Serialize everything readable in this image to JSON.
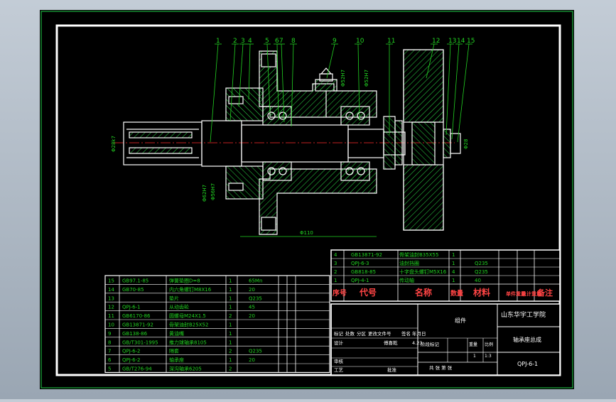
{
  "colors": {
    "background": "#000000",
    "frame": "#ffffff",
    "outer_border": "#1fd24a",
    "part_lines": "#ffffff",
    "hatch": "#2ee04a",
    "leaders": "#22d322",
    "center_lines": "#ff2a2a",
    "dimensions": "#22d322",
    "table_text": "#22d322",
    "title_accent": "#ff4444"
  },
  "balloons": [
    "1",
    "2",
    "3",
    "4",
    "5",
    "6",
    "7",
    "8",
    "9",
    "10",
    "11",
    "12",
    "13",
    "14",
    "15"
  ],
  "dimensions": {
    "left_shaft_dia": "Φ28k7",
    "right_dia": "Φ28",
    "flange_dia_a": "Φ62H7",
    "flange_dia_b": "Φ56H7",
    "top_dia_a": "Φ52H7",
    "top_dia_b": "Φ52H7",
    "length": "Φ110"
  },
  "bom_lower": {
    "rows": [
      {
        "no": "15",
        "code": "GB97.1-85",
        "name": "弹簧垫圈D=8",
        "qty": "1",
        "material": "65Mn"
      },
      {
        "no": "14",
        "code": "GB70-85",
        "name": "内六角螺钉M8X16",
        "qty": "1",
        "material": "20"
      },
      {
        "no": "13",
        "code": "",
        "name": "垫片",
        "qty": "1",
        "material": "Q235"
      },
      {
        "no": "12",
        "code": "QPJ-6-1",
        "name": "从动齿轮",
        "qty": "1",
        "material": "45"
      },
      {
        "no": "11",
        "code": "GB6170-86",
        "name": "圆螺母M24X1.5",
        "qty": "2",
        "material": "20"
      },
      {
        "no": "10",
        "code": "GB13871-92",
        "name": "骨架油封B25X52",
        "qty": "1",
        "material": ""
      },
      {
        "no": "9",
        "code": "GB138-86",
        "name": "黄油嘴",
        "qty": "1",
        "material": ""
      },
      {
        "no": "8",
        "code": "GB/T301-1995",
        "name": "推力球轴承8105",
        "qty": "1",
        "material": ""
      },
      {
        "no": "7",
        "code": "QPJ-6-2",
        "name": "隔套",
        "qty": "2",
        "material": "Q235"
      },
      {
        "no": "6",
        "code": "QPJ-6-2",
        "name": "轴承座",
        "qty": "1",
        "material": "20"
      },
      {
        "no": "5",
        "code": "GB/T276-94",
        "name": "深沟轴承6205",
        "qty": "2",
        "material": ""
      }
    ]
  },
  "bom_upper": {
    "rows": [
      {
        "no": "4",
        "code": "GB13871-92",
        "name": "骨架油封B35X55",
        "qty": "1",
        "material": ""
      },
      {
        "no": "3",
        "code": "QPJ-6-3",
        "name": "油封挡圈",
        "qty": "1",
        "material": "Q235"
      },
      {
        "no": "2",
        "code": "GB818-85",
        "name": "十字盘头螺钉M5X16",
        "qty": "4",
        "material": "Q235"
      },
      {
        "no": "1",
        "code": "QPJ-4-1",
        "name": "传动轴",
        "qty": "1",
        "material": "40"
      }
    ],
    "header": {
      "no": "序号",
      "code": "代号",
      "name": "名称",
      "qty": "数量",
      "material": "材料",
      "unit_weight": "单件重量",
      "total_weight": "总计重量",
      "remark": "备注"
    }
  },
  "title_block": {
    "school": "山东华宇工学院",
    "category": "组件",
    "drawing_name": "轴承座总成",
    "drawing_no": "QPJ-6-1",
    "designer": "傅喜乾",
    "date": "4.23",
    "scale": "1:3",
    "sheet_count": "1",
    "reviewer": "董涵",
    "labels": {
      "mark": "标记",
      "count": "处数",
      "zone": "分区",
      "change_doc": "更改文件号",
      "signature": "签名",
      "ymd": "年月日",
      "design": "设计",
      "standard": "标准化",
      "stage_mark": "阶段标记",
      "weight": "重量",
      "ratio": "比例",
      "audit": "审核",
      "process": "工艺",
      "approve": "批准",
      "total_sheets": "共 张 第 张"
    }
  }
}
